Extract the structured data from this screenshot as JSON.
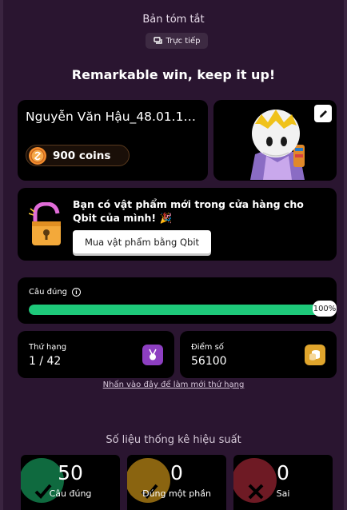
{
  "header": {
    "summary_title": "Bản tóm tắt",
    "live_label": "Trực tiếp",
    "headline": "Remarkable win, keep it up!"
  },
  "player": {
    "name": "Nguyễn Văn Hậu_48.01.10...",
    "coins": "900 coins"
  },
  "promo": {
    "text": "Bạn có vật phẩm mới trong cửa hàng cho Qbit của mình! 🎉",
    "button_label": "Mua vật phẩm bằng Qbit"
  },
  "accuracy": {
    "label": "Câu đúng",
    "percent_label": "100%",
    "percent": 100
  },
  "rank": {
    "label": "Thứ hạng",
    "value": "1 / 42"
  },
  "score": {
    "label": "Điểm số",
    "value": "56100"
  },
  "refresh_link": "Nhấn vào đây để làm mới thứ hạng",
  "performance": {
    "title": "Số liệu thống kê hiệu suất",
    "stats": [
      {
        "number": "50",
        "label": "Câu đúng",
        "color": "#0f6a3f",
        "icon": "check-icon"
      },
      {
        "number": "0",
        "label": "Đúng một phần",
        "color": "#8a6410",
        "icon": "check-icon"
      },
      {
        "number": "0",
        "label": "Sai",
        "color": "#6e1a24",
        "icon": "cross-icon"
      }
    ]
  },
  "colors": {
    "background": "#2a1530",
    "card": "#000000",
    "accuracy_fill": "#1ec97a",
    "rank_badge": "#8d3fc1",
    "score_badge": "#e0a52c"
  }
}
